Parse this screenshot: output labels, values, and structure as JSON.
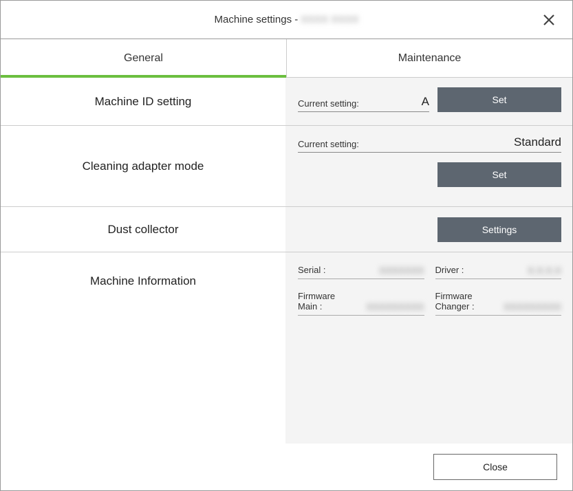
{
  "title_prefix": "Machine settings - ",
  "title_obscured": "XXXX XXXX",
  "tabs": {
    "general": "General",
    "maintenance": "Maintenance"
  },
  "rows": {
    "machine_id": {
      "label": "Machine ID setting",
      "current_setting_label": "Current setting:",
      "value": "A",
      "set_btn": "Set"
    },
    "cleaning": {
      "label": "Cleaning adapter mode",
      "current_setting_label": "Current setting:",
      "value": "Standard",
      "set_btn": "Set"
    },
    "dust": {
      "label": "Dust collector",
      "settings_btn": "Settings"
    },
    "info": {
      "label": "Machine Information",
      "serial_label": "Serial :",
      "serial_value": "XXXXXXX",
      "driver_label": "Driver :",
      "driver_value": "X.X.X.X",
      "fw_main_label": "Firmware\nMain :",
      "fw_main_value": "XXXXXXXXX",
      "fw_changer_label": "Firmware\nChanger :",
      "fw_changer_value": "XXXXXXXXX"
    }
  },
  "footer": {
    "close": "Close"
  }
}
